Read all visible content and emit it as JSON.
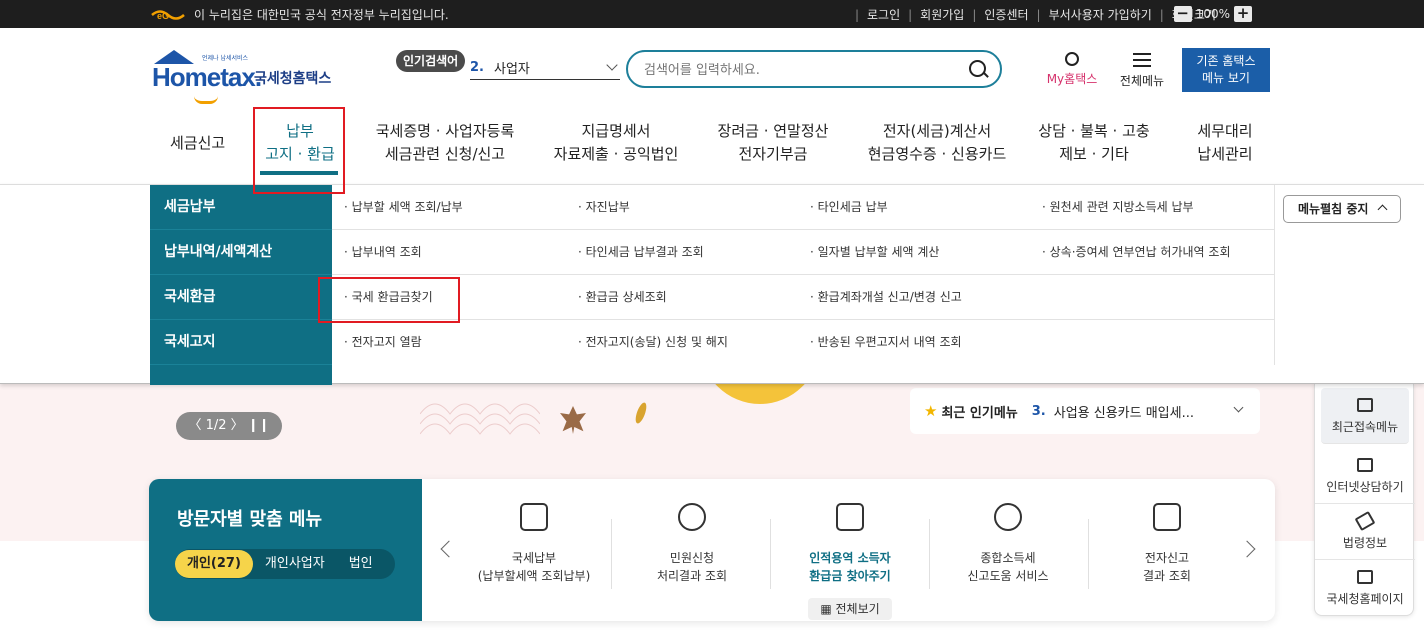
{
  "topbar": {
    "gov_text": "이 누리집은 대한민국 공식 전자정부 누리집입니다.",
    "links": [
      "로그인",
      "회원가입",
      "인증센터",
      "부서사용자 가입하기",
      "화면크기"
    ],
    "zoom": "100%"
  },
  "header": {
    "logo_text": "Hometax.",
    "logo_small": "언제나 납세서비스",
    "logo_kr": "국세청홈택스",
    "popular_badge": "인기검색어",
    "popular_num": "2.",
    "popular_term": "사업자",
    "search_placeholder": "검색어를 입력하세요.",
    "my_hometax": "My홈택스",
    "all_menu": "전체메뉴",
    "old_site_line1": "기존 홈택스",
    "old_site_line2": "메뉴 보기"
  },
  "gnb": [
    {
      "l1": "세금신고",
      "l2": ""
    },
    {
      "l1": "납부",
      "l2": "고지 · 환급"
    },
    {
      "l1": "국세증명 · 사업자등록",
      "l2": "세금관련 신청/신고"
    },
    {
      "l1": "지급명세서",
      "l2": "자료제출 · 공익법인"
    },
    {
      "l1": "장려금 · 연말정산",
      "l2": "전자기부금"
    },
    {
      "l1": "전자(세금)계산서",
      "l2": "현금영수증 · 신용카드"
    },
    {
      "l1": "상담 · 불복 · 고충",
      "l2": "제보 · 기타"
    },
    {
      "l1": "세무대리",
      "l2": "납세관리"
    }
  ],
  "dropdown": {
    "categories": [
      "세금납부",
      "납부내역/세액계산",
      "국세환급",
      "국세고지"
    ],
    "rows": [
      [
        "· 납부할 세액 조회/납부",
        "· 자진납부",
        "· 타인세금 납부",
        "· 원천세 관련 지방소득세 납부"
      ],
      [
        "· 납부내역 조회",
        "· 타인세금 납부결과 조회",
        "· 일자별 납부할 세액 계산",
        "· 상속·증여세 연부연납 허가내역 조회"
      ],
      [
        "· 국세 환급금찾기",
        "· 환급금 상세조회",
        "· 환급계좌개설 신고/변경 신고",
        ""
      ],
      [
        "· 전자고지 열람",
        "· 전자고지(송달) 신청 및 해지",
        "· 반송된 우편고지서 내역 조회",
        ""
      ]
    ],
    "stop_button": "메뉴펼침 중지"
  },
  "banner": {
    "pager": "〈  1/2  〉  ❙❙",
    "popular_menu_label": "최근 인기메뉴",
    "popular_menu_num": "3.",
    "popular_menu_text": "사업용 신용카드 매입세..."
  },
  "visitor": {
    "title": "방문자별 맞춤 메뉴",
    "tabs": [
      "개인(27)",
      "개인사업자",
      "법인"
    ],
    "items": [
      {
        "l1": "국세납부",
        "l2": "(납부할세액 조회납부)"
      },
      {
        "l1": "민원신청",
        "l2": "처리결과 조회"
      },
      {
        "l1": "인적용역 소득자",
        "l2": "환급금 찾아주기"
      },
      {
        "l1": "종합소득세",
        "l2": "신고도움 서비스"
      },
      {
        "l1": "전자신고",
        "l2": "결과 조회"
      }
    ],
    "see_all": "전체보기"
  },
  "quick": [
    "최근접속메뉴",
    "인터넷상담하기",
    "법령정보",
    "국세청홈페이지"
  ],
  "colors": {
    "primary": "#0f6f84",
    "brand": "#1d55a8",
    "highlight": "#e11b22"
  }
}
